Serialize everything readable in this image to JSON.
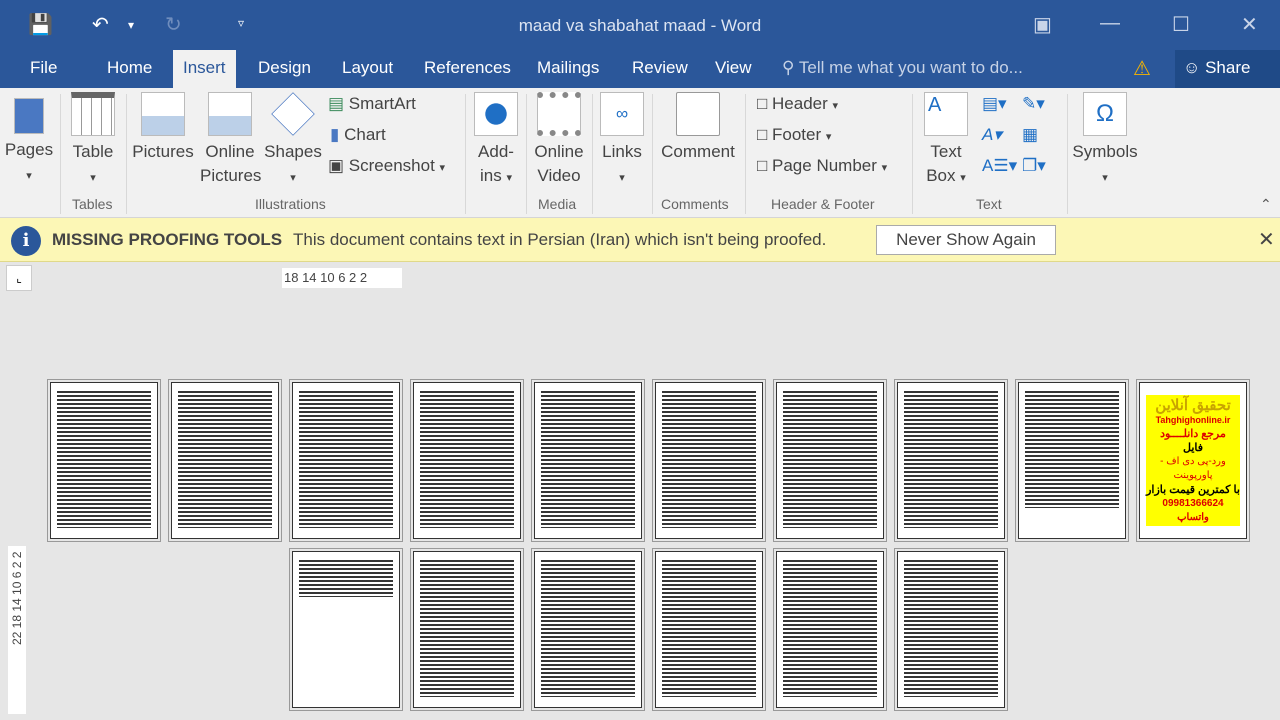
{
  "window": {
    "title": "maad va shabahat maad - Word"
  },
  "qat": {
    "save": "save-icon",
    "undo": "undo-icon",
    "redo": "redo-icon",
    "customize": "customize-qat-icon"
  },
  "tabs": [
    {
      "label": "File"
    },
    {
      "label": "Home"
    },
    {
      "label": "Insert"
    },
    {
      "label": "Design"
    },
    {
      "label": "Layout"
    },
    {
      "label": "References"
    },
    {
      "label": "Mailings"
    },
    {
      "label": "Review"
    },
    {
      "label": "View"
    }
  ],
  "active_tab": "Insert",
  "tell_me": "Tell me what you want to do...",
  "share": "Share",
  "ribbon": {
    "pages": "Pages",
    "table": "Table",
    "pictures": "Pictures",
    "online_pictures": [
      "Online",
      "Pictures"
    ],
    "shapes": "Shapes",
    "smartart": "SmartArt",
    "chart": "Chart",
    "screenshot": "Screenshot",
    "addins": [
      "Add-",
      "ins"
    ],
    "online_video": [
      "Online",
      "Video"
    ],
    "links": "Links",
    "comment": "Comment",
    "header": "Header",
    "footer": "Footer",
    "page_number": "Page Number",
    "text_box": [
      "Text",
      "Box"
    ],
    "symbols": "Symbols",
    "groups": {
      "tables": "Tables",
      "illustrations": "Illustrations",
      "media": "Media",
      "comments": "Comments",
      "header_footer": "Header & Footer",
      "text": "Text"
    }
  },
  "message": {
    "title": "MISSING PROOFING TOOLS",
    "text": "This document contains text in Persian (Iran) which isn't being proofed.",
    "button": "Never Show Again"
  },
  "ruler": {
    "horizontal": "18 14 10  6   2   2",
    "vertical": "22 18 14 10  6  2  2"
  },
  "ad_page": {
    "title": "تحقیق آنلاین",
    "site": "Tahghighonline.ir",
    "line1": "مرجع دانلــــود",
    "line2": "فایل",
    "line3": "ورد-پی دی اف - پاورپوینت",
    "line4": "با کمترین قیمت بازار",
    "phone": "09981366624 واتساپ"
  }
}
